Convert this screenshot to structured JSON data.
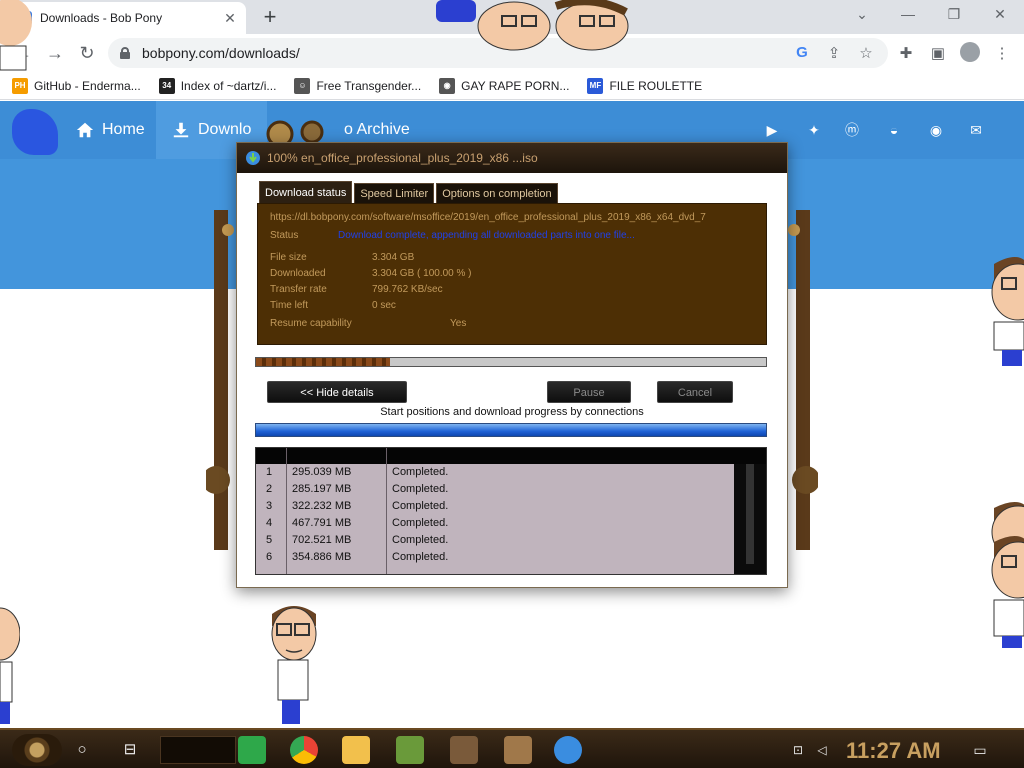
{
  "browser": {
    "tab_title": "Downloads - Bob Pony",
    "tab_close": "✕",
    "new_tab": "+",
    "url": "bobpony.com/downloads/",
    "window_controls": {
      "dropdown": "⌄",
      "minimize": "—",
      "restore": "❐",
      "close": "✕"
    },
    "bookmarks": [
      {
        "label": "GitHub - Enderma...",
        "icon": "PH",
        "color": "#f59c00"
      },
      {
        "label": "Index of ~dartz/i...",
        "icon": "34",
        "color": "#222222"
      },
      {
        "label": "Free Transgender...",
        "icon": "☺",
        "color": "#555555"
      },
      {
        "label": "GAY RAPE PORN...",
        "icon": "◉",
        "color": "#555555"
      },
      {
        "label": "FILE ROULETTE",
        "icon": "MF",
        "color": "#2a5ad8"
      }
    ]
  },
  "site": {
    "nav": {
      "home": "Home",
      "downloads": "Downlo",
      "archive": "o Archive"
    },
    "social_icons": [
      "youtube-icon",
      "twitter-icon",
      "mastodon-icon",
      "discord-icon",
      "github-icon",
      "email-icon"
    ]
  },
  "dialog": {
    "title": "100% en_office_professional_plus_2019_x86 ...iso",
    "tabs": [
      "Download status",
      "Speed Limiter",
      "Options on completion"
    ],
    "info": {
      "url": "https://dl.bobpony.com/software/msoffice/2019/en_office_professional_plus_2019_x86_x64_dvd_7",
      "status_label": "Status",
      "status_value": "Download complete, appending all downloaded parts into one file...",
      "file_size_label": "File size",
      "file_size_value": "3.304  GB",
      "downloaded_label": "Downloaded",
      "downloaded_value": "3.304  GB  ( 100.00 % )",
      "rate_label": "Transfer rate",
      "rate_value": "799.762  KB/sec",
      "time_left_label": "Time left",
      "time_left_value": "0 sec",
      "resume_label": "Resume capability",
      "resume_value": "Yes"
    },
    "buttons": {
      "hide_details": "<< Hide details",
      "pause": "Pause",
      "cancel": "Cancel"
    },
    "connections_caption": "Start positions and download progress by connections",
    "connections": [
      {
        "n": "1",
        "size": "295.039  MB",
        "info": "Completed."
      },
      {
        "n": "2",
        "size": "285.197  MB",
        "info": "Completed."
      },
      {
        "n": "3",
        "size": "322.232  MB",
        "info": "Completed."
      },
      {
        "n": "4",
        "size": "467.791  MB",
        "info": "Completed."
      },
      {
        "n": "5",
        "size": "702.521  MB",
        "info": "Completed."
      },
      {
        "n": "6",
        "size": "354.886  MB",
        "info": "Completed."
      }
    ]
  },
  "taskbar": {
    "clock": "11:27 AM",
    "apps": [
      "notes-app-icon",
      "chrome-icon",
      "file-explorer-icon",
      "minecraft-icon",
      "game-launcher-icon",
      "character-app-icon",
      "download-manager-icon"
    ]
  },
  "colors": {
    "nav_blue": "#3d8dd6",
    "panel_brown": "#4d2f05",
    "status_blue": "#2040e8",
    "clock_gold": "#c8a060"
  }
}
